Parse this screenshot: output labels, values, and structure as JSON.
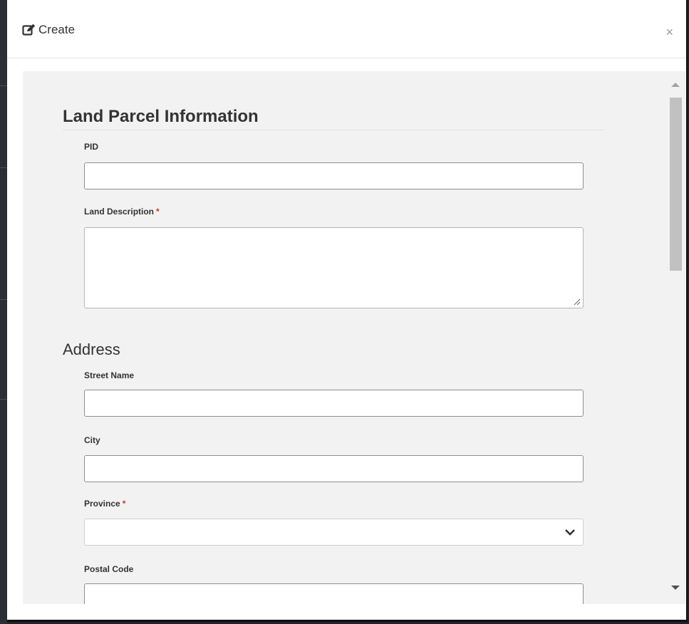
{
  "header": {
    "title": "Create",
    "close_label": "×"
  },
  "form": {
    "section_title": "Land Parcel Information",
    "pid_label": "PID",
    "land_description_label": "Land Description",
    "required_mark": "*",
    "address_title": "Address",
    "street_name_label": "Street Name",
    "city_label": "City",
    "province_label": "Province",
    "postal_code_label": "Postal Code",
    "pid_value": "",
    "street_name_value": "",
    "city_value": "",
    "postal_code_value": "",
    "province_selected": ""
  },
  "icons": {
    "header": "edit-icon",
    "close": "close-icon",
    "select": "chevron-down-icon",
    "resize": "resize-handle-icon"
  }
}
